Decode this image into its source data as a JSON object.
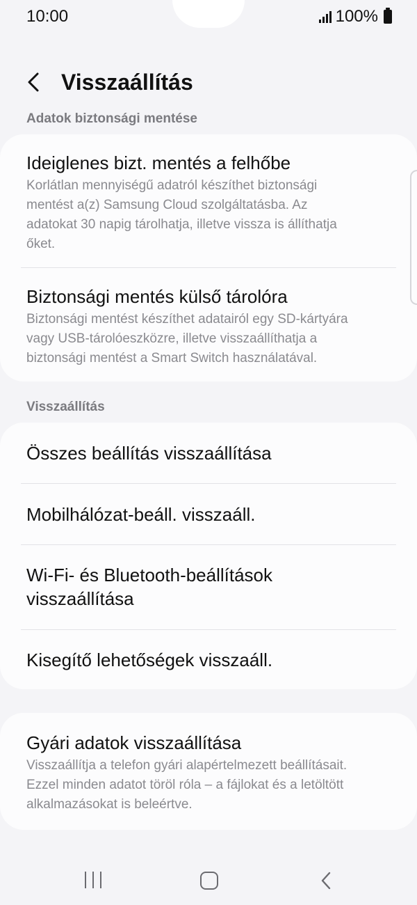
{
  "status_bar": {
    "time": "10:00",
    "battery": "100%",
    "icons": [
      "signal-icon",
      "battery-icon"
    ]
  },
  "header": {
    "back_icon": "chevron-left-icon",
    "title": "Visszaállítás"
  },
  "sections": {
    "backup_label": "Adatok biztonsági mentése",
    "reset_label": "Visszaállítás"
  },
  "backup_items": [
    {
      "title": "Ideiglenes bizt. mentés a felhőbe",
      "desc_lines": [
        "Korlátlan mennyiségű adatról készíthet biztonsági",
        "mentést a(z) Samsung Cloud szolgáltatásba. Az",
        "adatokat 30 napig tárolhatja, illetve vissza is állíthatja",
        "őket."
      ]
    },
    {
      "title": "Biztonsági mentés külső tárolóra",
      "desc_lines": [
        "Biztonsági mentést készíthet adatairól egy SD-kártyára",
        "vagy USB-tárolóeszközre, illetve visszaállíthatja a",
        "biztonsági mentést a Smart Switch használatával."
      ]
    }
  ],
  "reset_items": [
    {
      "title_lines": [
        "Összes beállítás visszaállítása"
      ]
    },
    {
      "title_lines": [
        "Mobilhálózat-beáll. visszaáll."
      ]
    },
    {
      "title_lines": [
        "Wi-Fi- és Bluetooth-beállítások",
        "visszaállítása"
      ]
    },
    {
      "title_lines": [
        "Kisegítő lehetőségek visszaáll."
      ]
    }
  ],
  "factory_reset": {
    "title": "Gyári adatok visszaállítása",
    "desc_lines": [
      "Visszaállítja a telefon gyári alapértelmezett beállításait.",
      "Ezzel minden adatot töröl róla – a fájlokat és a letöltött",
      "alkalmazásokat is beleértve."
    ]
  },
  "nav_bar": {
    "icons": [
      "recent-apps-icon",
      "home-icon",
      "back-icon"
    ]
  }
}
